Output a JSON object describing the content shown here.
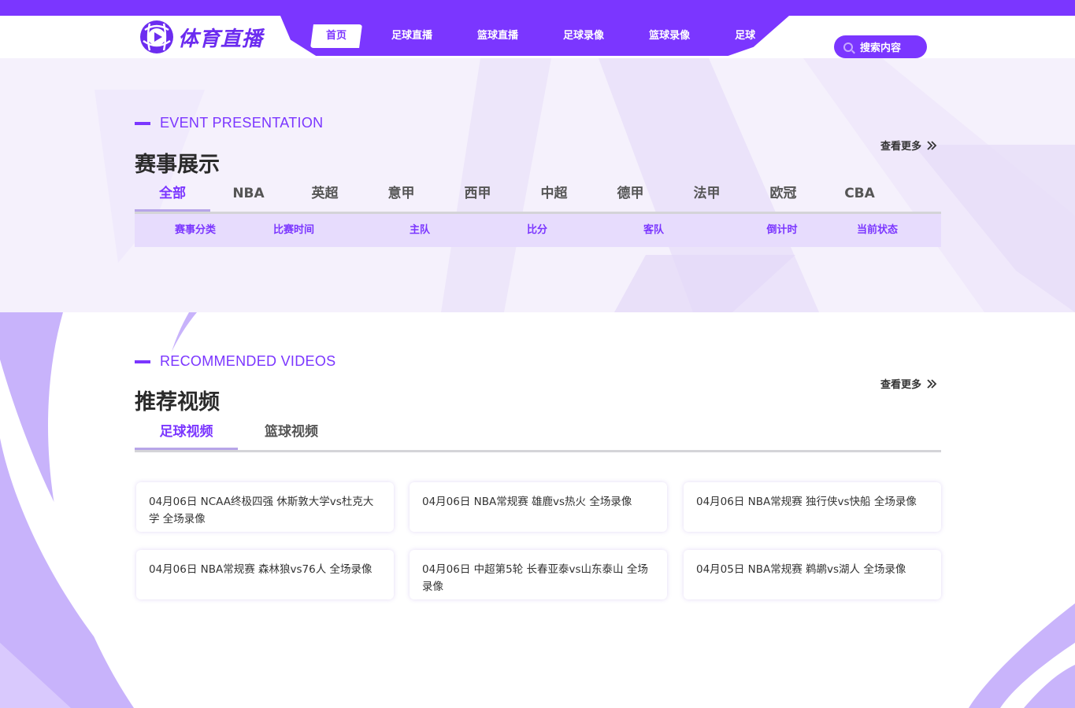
{
  "brand": {
    "logo_text": "体育直播"
  },
  "nav": {
    "items": [
      "首页",
      "足球直播",
      "篮球直播",
      "足球录像",
      "篮球录像",
      "足球"
    ]
  },
  "search": {
    "label": "搜索内容"
  },
  "events": {
    "title_en": "EVENT PRESENTATION",
    "title_cn": "赛事展示",
    "more": "查看更多",
    "tabs": [
      "全部",
      "NBA",
      "英超",
      "意甲",
      "西甲",
      "中超",
      "德甲",
      "法甲",
      "欧冠",
      "CBA"
    ],
    "columns": [
      "赛事分类",
      "比赛时间",
      "主队",
      "比分",
      "客队",
      "倒计时",
      "当前状态"
    ]
  },
  "videos": {
    "title_en": "RECOMMENDED VIDEOS",
    "title_cn": "推荐视频",
    "more": "查看更多",
    "tabs": [
      "足球视频",
      "篮球视频"
    ],
    "cards": [
      "04月06日 NCAA终极四强 休斯敦大学vs杜克大学 全场录像",
      "04月06日 NBA常规赛 雄鹿vs热火 全场录像",
      "04月06日 NBA常规赛 独行侠vs快船 全场录像",
      "04月06日 NBA常规赛 森林狼vs76人 全场录像",
      "04月06日 中超第5轮 长春亚泰vs山东泰山 全场录像",
      "04月05日 NBA常规赛 鹈鹕vs湖人 全场录像"
    ]
  },
  "colors": {
    "accent": "#7b36ff",
    "table_header_bg": "#e7dcfd"
  }
}
